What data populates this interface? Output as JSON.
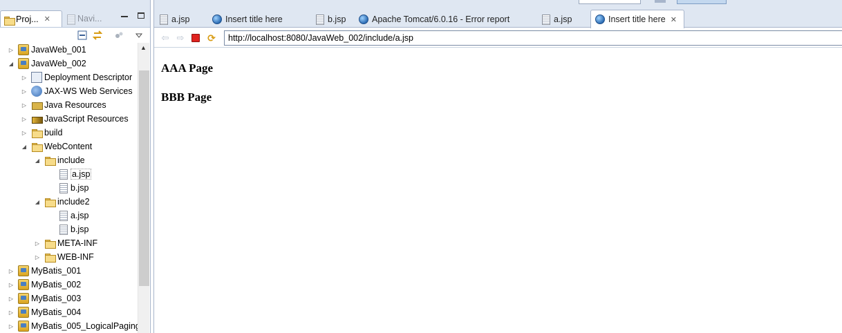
{
  "left_panel": {
    "tabs": [
      {
        "label": "Proj...",
        "icon": "project-explorer-icon"
      },
      {
        "label": "Navi...",
        "icon": "navigator-icon"
      }
    ],
    "tree": [
      {
        "label": "JavaWeb_001",
        "icon": "project-icon",
        "twisty": "collapsed"
      },
      {
        "label": "JavaWeb_002",
        "icon": "project-icon",
        "twisty": "expanded"
      },
      {
        "label": "Deployment Descriptor",
        "icon": "deployment-descriptor-icon",
        "twisty": "collapsed"
      },
      {
        "label": "JAX-WS Web Services",
        "icon": "web-services-icon",
        "twisty": "collapsed"
      },
      {
        "label": "Java Resources",
        "icon": "java-resources-icon",
        "twisty": "collapsed"
      },
      {
        "label": "JavaScript Resources",
        "icon": "javascript-resources-icon",
        "twisty": "collapsed"
      },
      {
        "label": "build",
        "icon": "folder-icon",
        "twisty": "collapsed"
      },
      {
        "label": "WebContent",
        "icon": "folder-icon",
        "twisty": "expanded"
      },
      {
        "label": "include",
        "icon": "folder-icon",
        "twisty": "expanded"
      },
      {
        "label": "a.jsp",
        "icon": "jsp-file-icon",
        "twisty": "none",
        "selected": true
      },
      {
        "label": "b.jsp",
        "icon": "jsp-file-icon",
        "twisty": "none"
      },
      {
        "label": "include2",
        "icon": "folder-icon",
        "twisty": "expanded"
      },
      {
        "label": "a.jsp",
        "icon": "jsp-file-icon",
        "twisty": "none"
      },
      {
        "label": "b.jsp",
        "icon": "jsp-file-icon",
        "twisty": "none"
      },
      {
        "label": "META-INF",
        "icon": "folder-icon",
        "twisty": "collapsed"
      },
      {
        "label": "WEB-INF",
        "icon": "folder-icon",
        "twisty": "collapsed"
      },
      {
        "label": "MyBatis_001",
        "icon": "project-icon",
        "twisty": "collapsed"
      },
      {
        "label": "MyBatis_002",
        "icon": "project-icon",
        "twisty": "collapsed"
      },
      {
        "label": "MyBatis_003",
        "icon": "project-icon",
        "twisty": "collapsed"
      },
      {
        "label": "MyBatis_004",
        "icon": "project-icon",
        "twisty": "collapsed"
      },
      {
        "label": "MyBatis_005_LogicalPaging",
        "icon": "project-icon",
        "twisty": "collapsed"
      }
    ]
  },
  "editor_tabs": [
    {
      "label": "a.jsp",
      "icon": "jsp-file-icon"
    },
    {
      "label": "Insert title here",
      "icon": "globe-icon"
    },
    {
      "label": "b.jsp",
      "icon": "jsp-file-icon"
    },
    {
      "label": "Apache Tomcat/6.0.16 - Error report",
      "icon": "globe-icon"
    },
    {
      "label": "a.jsp",
      "icon": "jsp-file-icon"
    },
    {
      "label": "Insert title here",
      "icon": "globe-icon",
      "active": true
    }
  ],
  "browser": {
    "url": "http://localhost:8080/JavaWeb_002/include/a.jsp"
  },
  "page": {
    "headings": [
      "AAA Page",
      "BBB Page"
    ]
  },
  "colors": {
    "tab_strip": "#dfe7f2",
    "border": "#a7b5cb",
    "stop_red": "#e0231f"
  }
}
